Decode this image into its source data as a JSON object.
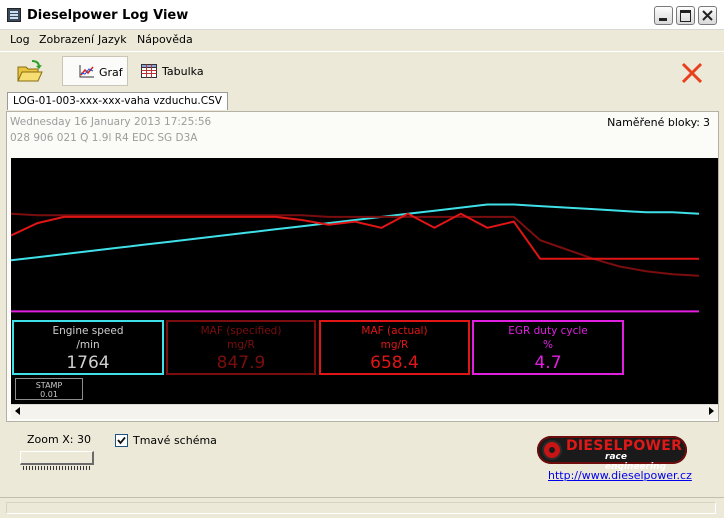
{
  "window": {
    "title": "Dieselpower Log View"
  },
  "menu": {
    "items": [
      "Log",
      "Zobrazení",
      "Jazyk",
      "Nápověda"
    ]
  },
  "toolbar": {
    "graf_label": "Graf",
    "tabulka_label": "Tabulka"
  },
  "file_tab": {
    "label": "LOG-01-003-xxx-xxx-vaha vzduchu.CSV"
  },
  "log_info": {
    "date": "Wednesday 16 January 2013 17:25:56",
    "ecu": "028 906 021 Q  1.9l R4 EDC SG       D3A",
    "blocks_label": "Naměřené bloky:",
    "blocks_value": "3"
  },
  "gauges": [
    {
      "name": "Engine speed",
      "unit": "/min",
      "value": "1764",
      "color": "#3FE0E8",
      "value_color": "#CFCFCF"
    },
    {
      "name": "MAF (specified)",
      "unit": "mg/R",
      "value": "847.9",
      "color": "#7A0E0E",
      "value_color": "#7A0E0E"
    },
    {
      "name": "MAF (actual)",
      "unit": "mg/R",
      "value": "658.4",
      "color": "#E01515",
      "value_color": "#E01515"
    },
    {
      "name": "EGR duty cycle",
      "unit": "%",
      "value": "4.7",
      "color": "#E01FE0",
      "value_color": "#E01FE0"
    }
  ],
  "stamp": {
    "label": "STAMP",
    "value": "0.01"
  },
  "zoom": {
    "label": "Zoom X: 30",
    "value": 30
  },
  "dark_scheme": {
    "label": "Tmavé schéma",
    "checked": true
  },
  "logo": {
    "line1": "DIESELPOWER",
    "line2": "race engineering"
  },
  "link": {
    "label": "http://www.dieselpower.cz"
  },
  "chart_data": {
    "type": "line",
    "series": [
      {
        "color": "#3FE0E8",
        "values": [
          0.34,
          0.36,
          0.38,
          0.4,
          0.42,
          0.44,
          0.46,
          0.48,
          0.5,
          0.52,
          0.54,
          0.56,
          0.58,
          0.6,
          0.62,
          0.64,
          0.66,
          0.68,
          0.7,
          0.7,
          0.69,
          0.68,
          0.67,
          0.66,
          0.65,
          0.65,
          0.64
        ]
      },
      {
        "color": "#7A0E0E",
        "values": [
          0.64,
          0.63,
          0.63,
          0.63,
          0.63,
          0.63,
          0.63,
          0.63,
          0.63,
          0.63,
          0.63,
          0.63,
          0.62,
          0.62,
          0.62,
          0.62,
          0.62,
          0.62,
          0.62,
          0.62,
          0.47,
          0.41,
          0.35,
          0.3,
          0.27,
          0.25,
          0.24
        ]
      },
      {
        "color": "#E01515",
        "values": [
          0.5,
          0.58,
          0.62,
          0.62,
          0.62,
          0.62,
          0.62,
          0.62,
          0.62,
          0.62,
          0.62,
          0.6,
          0.57,
          0.59,
          0.55,
          0.64,
          0.55,
          0.64,
          0.55,
          0.59,
          0.35,
          0.35,
          0.35,
          0.35,
          0.35,
          0.35,
          0.35
        ]
      },
      {
        "color": "#E01FE0",
        "values": [
          0.01,
          0.01,
          0.01,
          0.01,
          0.01,
          0.01,
          0.01,
          0.01,
          0.01,
          0.01,
          0.01,
          0.01,
          0.01,
          0.01,
          0.01,
          0.01,
          0.01,
          0.01,
          0.01,
          0.01,
          0.01,
          0.01,
          0.01,
          0.01,
          0.01,
          0.01,
          0.01
        ]
      }
    ]
  }
}
